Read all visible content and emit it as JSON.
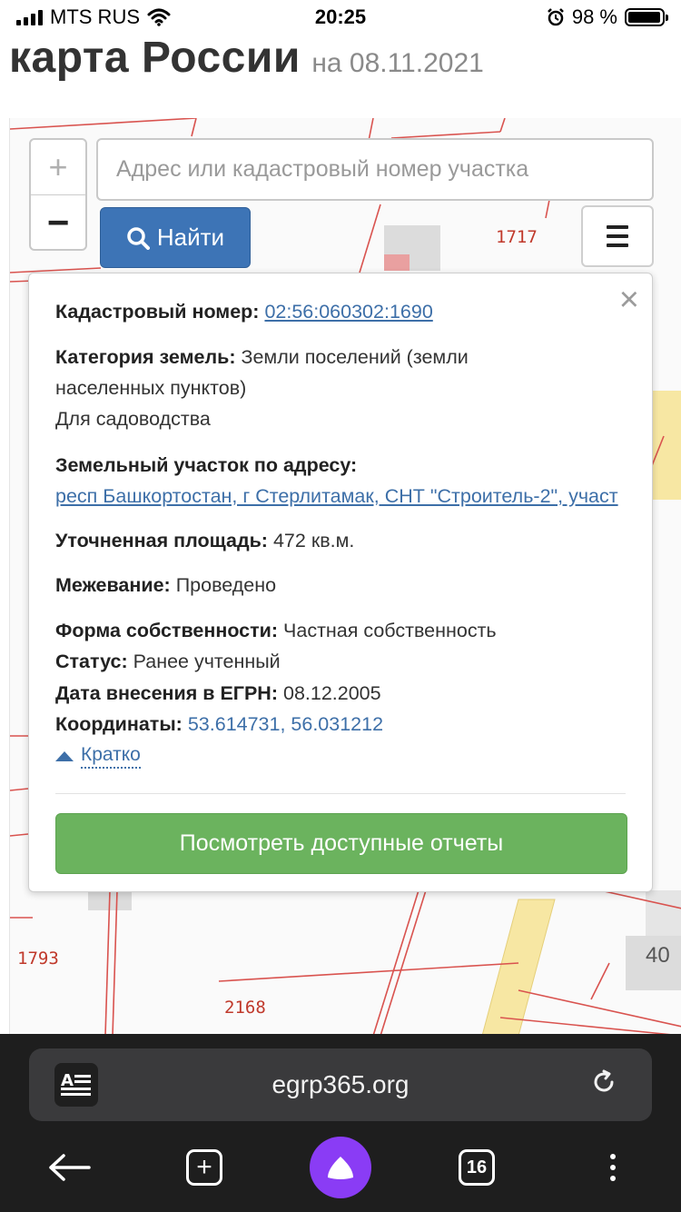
{
  "status_bar": {
    "carrier": "MTS RUS",
    "time": "20:25",
    "battery_percent": "98 %",
    "battery_level": 0.98
  },
  "header": {
    "title": "карта России",
    "date": "на 08.11.2021"
  },
  "map": {
    "zoom_in": "+",
    "zoom_out": "−",
    "search_placeholder": "Адрес или кадастровый номер участка",
    "find_label": "Найти",
    "plot_labels": [
      "1717",
      "1793",
      "2168",
      "40"
    ]
  },
  "popup": {
    "close": "×",
    "cadastral_label": "Кадастровый номер:",
    "cadastral_value": "02:56:060302:1690",
    "category_label": "Категория земель:",
    "category_value_1": "Земли поселений (земли",
    "category_value_2": "населенных пунктов)",
    "category_value_3": "Для садоводства",
    "address_label": "Земельный участок по адресу:",
    "address_value": "респ Башкортостан, г Стерлитамак, СНТ \"Строитель-2\", участ",
    "area_label": "Уточненная площадь:",
    "area_value": "472 кв.м.",
    "survey_label": "Межевание:",
    "survey_value": "Проведено",
    "ownership_label": "Форма собственности:",
    "ownership_value": "Частная собственность",
    "status_label": "Статус:",
    "status_value": "Ранее учтенный",
    "egrn_label": "Дата внесения в ЕГРН:",
    "egrn_value": "08.12.2005",
    "coords_label": "Координаты:",
    "coords_value": "53.614731, 56.031212",
    "brief_label": "Кратко",
    "reports_button": "Посмотреть доступные отчеты"
  },
  "browser": {
    "url": "egrp365.org",
    "tabs_count": "16"
  },
  "colors": {
    "accent_blue": "#3d74b6",
    "report_green": "#6bb35e",
    "plot_red": "#c0392b",
    "road_yellow": "#f7e7a3"
  }
}
